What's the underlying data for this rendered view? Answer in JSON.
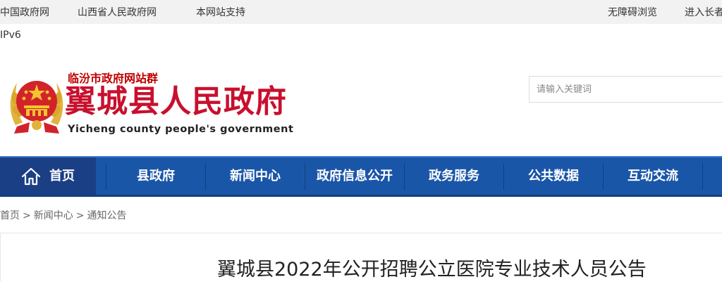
{
  "topbar": {
    "links": [
      "中国政府网",
      "山西省人民政府网",
      "本网站支持"
    ],
    "right_links": [
      "无障碍浏览",
      "进入长者"
    ]
  },
  "ipv6_label": "IPv6",
  "header": {
    "site_group": "临汾市政府网站群",
    "title": "翼城县人民政府",
    "subtitle": "Yicheng county people's government",
    "emblem_icon": "national-emblem-icon"
  },
  "search": {
    "placeholder": "请输入关键词",
    "value": ""
  },
  "nav": {
    "home_label": "首页",
    "items": [
      "县政府",
      "新闻中心",
      "政府信息公开",
      "政务服务",
      "公共数据",
      "互动交流"
    ],
    "colors": {
      "bar": "#1a56a8",
      "home": "#1b3f85"
    }
  },
  "breadcrumb": {
    "items": [
      "首页",
      "新闻中心",
      "通知公告"
    ],
    "separator": ">"
  },
  "article": {
    "title": "翼城县2022年公开招聘公立医院专业技术人员公告"
  },
  "colors": {
    "title_red": "#c8102e",
    "topbar_bg": "#f2f2f2"
  }
}
